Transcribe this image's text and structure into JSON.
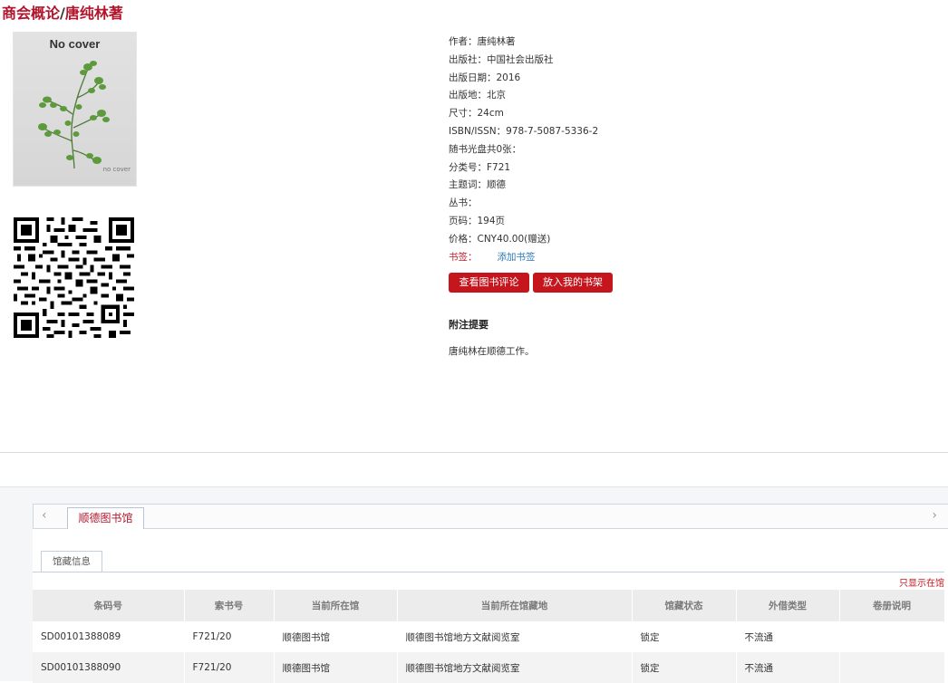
{
  "page": {
    "title_main": "商会概论",
    "title_sep": "/",
    "title_author": "唐纯林著"
  },
  "cover": {
    "no_cover_text": "No cover",
    "no_cover_small": "no cover"
  },
  "meta": {
    "author": "作者：唐纯林著",
    "publisher": "出版社：中国社会出版社",
    "pub_date": "出版日期：2016",
    "pub_place": "出版地：北京",
    "size": "尺寸：24cm",
    "isbn": "ISBN/ISSN：978-7-5087-5336-2",
    "disc": "随书光盘共0张：",
    "class_no": "分类号：F721",
    "subject": "主题词：顺德",
    "series": "丛书：",
    "pages": "页码：194页",
    "price": "价格：CNY40.00(赠送)",
    "bookmark_label": "书签：",
    "bookmark_link": "添加书签"
  },
  "buttons": {
    "review": "查看图书评论",
    "shelf": "放入我的书架"
  },
  "notes": {
    "heading": "附注提要",
    "text": "唐纯林在顺德工作。"
  },
  "tabs": {
    "nav_left": "‹",
    "nav_right": "›",
    "library_tab": "顺德图书馆",
    "holdings_subtab": "馆藏信息",
    "only_show": "只显示在馆"
  },
  "holdings": {
    "headers": [
      "条码号",
      "索书号",
      "当前所在馆",
      "当前所在馆藏地",
      "馆藏状态",
      "外借类型",
      "卷册说明"
    ],
    "rows": [
      [
        "SD00101388089",
        "F721/20",
        "顺德图书馆",
        "顺德图书馆地方文献阅览室",
        "锁定",
        "不流通",
        ""
      ],
      [
        "SD00101388090",
        "F721/20",
        "顺德图书馆",
        "顺德图书馆地方文献阅览室",
        "锁定",
        "不流通",
        ""
      ]
    ]
  },
  "colors": {
    "accent_red": "#c4161c",
    "title_red": "#b1142b",
    "link_blue": "#2e7ab8"
  }
}
